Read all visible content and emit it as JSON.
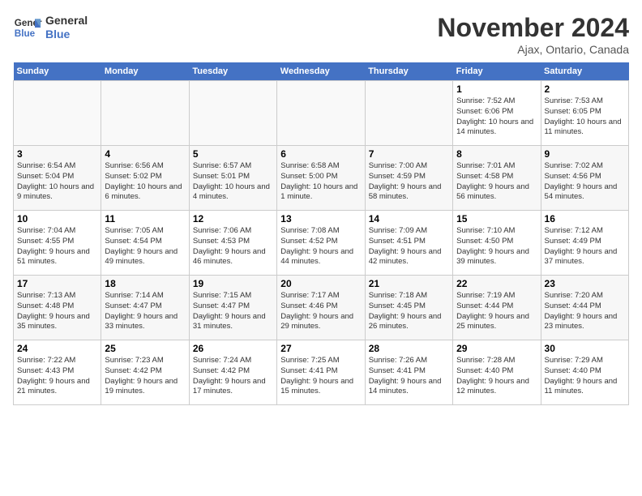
{
  "header": {
    "logo_line1": "General",
    "logo_line2": "Blue",
    "month": "November 2024",
    "location": "Ajax, Ontario, Canada"
  },
  "days_of_week": [
    "Sunday",
    "Monday",
    "Tuesday",
    "Wednesday",
    "Thursday",
    "Friday",
    "Saturday"
  ],
  "weeks": [
    [
      {
        "day": "",
        "info": ""
      },
      {
        "day": "",
        "info": ""
      },
      {
        "day": "",
        "info": ""
      },
      {
        "day": "",
        "info": ""
      },
      {
        "day": "",
        "info": ""
      },
      {
        "day": "1",
        "info": "Sunrise: 7:52 AM\nSunset: 6:06 PM\nDaylight: 10 hours and 14 minutes."
      },
      {
        "day": "2",
        "info": "Sunrise: 7:53 AM\nSunset: 6:05 PM\nDaylight: 10 hours and 11 minutes."
      }
    ],
    [
      {
        "day": "3",
        "info": "Sunrise: 6:54 AM\nSunset: 5:04 PM\nDaylight: 10 hours and 9 minutes."
      },
      {
        "day": "4",
        "info": "Sunrise: 6:56 AM\nSunset: 5:02 PM\nDaylight: 10 hours and 6 minutes."
      },
      {
        "day": "5",
        "info": "Sunrise: 6:57 AM\nSunset: 5:01 PM\nDaylight: 10 hours and 4 minutes."
      },
      {
        "day": "6",
        "info": "Sunrise: 6:58 AM\nSunset: 5:00 PM\nDaylight: 10 hours and 1 minute."
      },
      {
        "day": "7",
        "info": "Sunrise: 7:00 AM\nSunset: 4:59 PM\nDaylight: 9 hours and 58 minutes."
      },
      {
        "day": "8",
        "info": "Sunrise: 7:01 AM\nSunset: 4:58 PM\nDaylight: 9 hours and 56 minutes."
      },
      {
        "day": "9",
        "info": "Sunrise: 7:02 AM\nSunset: 4:56 PM\nDaylight: 9 hours and 54 minutes."
      }
    ],
    [
      {
        "day": "10",
        "info": "Sunrise: 7:04 AM\nSunset: 4:55 PM\nDaylight: 9 hours and 51 minutes."
      },
      {
        "day": "11",
        "info": "Sunrise: 7:05 AM\nSunset: 4:54 PM\nDaylight: 9 hours and 49 minutes."
      },
      {
        "day": "12",
        "info": "Sunrise: 7:06 AM\nSunset: 4:53 PM\nDaylight: 9 hours and 46 minutes."
      },
      {
        "day": "13",
        "info": "Sunrise: 7:08 AM\nSunset: 4:52 PM\nDaylight: 9 hours and 44 minutes."
      },
      {
        "day": "14",
        "info": "Sunrise: 7:09 AM\nSunset: 4:51 PM\nDaylight: 9 hours and 42 minutes."
      },
      {
        "day": "15",
        "info": "Sunrise: 7:10 AM\nSunset: 4:50 PM\nDaylight: 9 hours and 39 minutes."
      },
      {
        "day": "16",
        "info": "Sunrise: 7:12 AM\nSunset: 4:49 PM\nDaylight: 9 hours and 37 minutes."
      }
    ],
    [
      {
        "day": "17",
        "info": "Sunrise: 7:13 AM\nSunset: 4:48 PM\nDaylight: 9 hours and 35 minutes."
      },
      {
        "day": "18",
        "info": "Sunrise: 7:14 AM\nSunset: 4:47 PM\nDaylight: 9 hours and 33 minutes."
      },
      {
        "day": "19",
        "info": "Sunrise: 7:15 AM\nSunset: 4:47 PM\nDaylight: 9 hours and 31 minutes."
      },
      {
        "day": "20",
        "info": "Sunrise: 7:17 AM\nSunset: 4:46 PM\nDaylight: 9 hours and 29 minutes."
      },
      {
        "day": "21",
        "info": "Sunrise: 7:18 AM\nSunset: 4:45 PM\nDaylight: 9 hours and 26 minutes."
      },
      {
        "day": "22",
        "info": "Sunrise: 7:19 AM\nSunset: 4:44 PM\nDaylight: 9 hours and 25 minutes."
      },
      {
        "day": "23",
        "info": "Sunrise: 7:20 AM\nSunset: 4:44 PM\nDaylight: 9 hours and 23 minutes."
      }
    ],
    [
      {
        "day": "24",
        "info": "Sunrise: 7:22 AM\nSunset: 4:43 PM\nDaylight: 9 hours and 21 minutes."
      },
      {
        "day": "25",
        "info": "Sunrise: 7:23 AM\nSunset: 4:42 PM\nDaylight: 9 hours and 19 minutes."
      },
      {
        "day": "26",
        "info": "Sunrise: 7:24 AM\nSunset: 4:42 PM\nDaylight: 9 hours and 17 minutes."
      },
      {
        "day": "27",
        "info": "Sunrise: 7:25 AM\nSunset: 4:41 PM\nDaylight: 9 hours and 15 minutes."
      },
      {
        "day": "28",
        "info": "Sunrise: 7:26 AM\nSunset: 4:41 PM\nDaylight: 9 hours and 14 minutes."
      },
      {
        "day": "29",
        "info": "Sunrise: 7:28 AM\nSunset: 4:40 PM\nDaylight: 9 hours and 12 minutes."
      },
      {
        "day": "30",
        "info": "Sunrise: 7:29 AM\nSunset: 4:40 PM\nDaylight: 9 hours and 11 minutes."
      }
    ]
  ]
}
